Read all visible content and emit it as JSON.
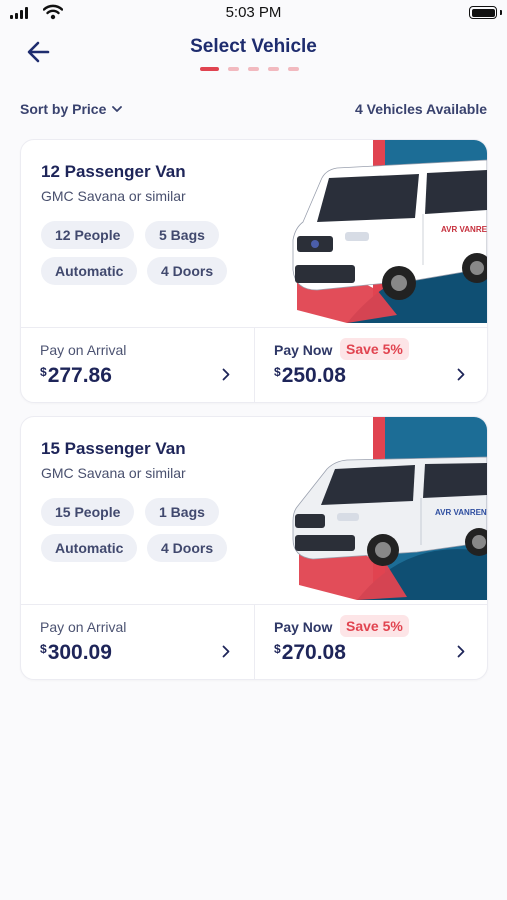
{
  "status_bar": {
    "time": "5:03 PM"
  },
  "header": {
    "title": "Select Vehicle",
    "steps_total": 5,
    "step_active": 1
  },
  "toolbar": {
    "sort_label": "Sort by Price",
    "count_label": "4 Vehicles Available"
  },
  "vehicles": [
    {
      "name": "12 Passenger Van",
      "model": "GMC Savana or similar",
      "features": [
        "12 People",
        "5 Bags",
        "Automatic",
        "4 Doors"
      ],
      "brand_text": "AVR VANRENTAL",
      "pay_arrival": {
        "label": "Pay on Arrival",
        "currency": "$",
        "price": "277.86"
      },
      "pay_now": {
        "label": "Pay Now",
        "badge": "Save 5%",
        "currency": "$",
        "price": "250.08"
      }
    },
    {
      "name": "15 Passenger Van",
      "model": "GMC Savana or similar",
      "features": [
        "15 People",
        "1 Bags",
        "Automatic",
        "4 Doors"
      ],
      "brand_text": "AVR VANRENTAL",
      "pay_arrival": {
        "label": "Pay on Arrival",
        "currency": "$",
        "price": "300.09"
      },
      "pay_now": {
        "label": "Pay Now",
        "badge": "Save 5%",
        "currency": "$",
        "price": "270.08"
      }
    }
  ],
  "colors": {
    "navy": "#1e2559",
    "accent_red": "#e04350",
    "teal_blue": "#1c6d96",
    "pill_bg": "#eef0f6"
  }
}
